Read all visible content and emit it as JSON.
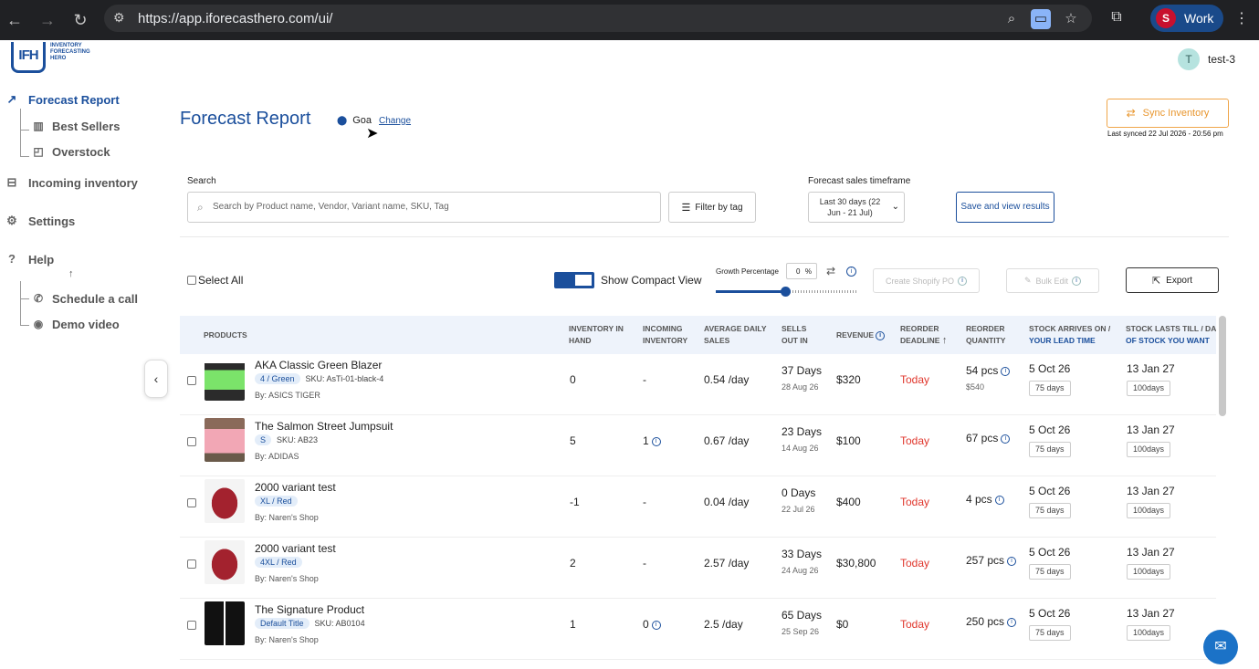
{
  "browser": {
    "url": "https://app.iforecasthero.com/ui/",
    "profile_label": "Work"
  },
  "logo": {
    "mark": "IFH",
    "line1": "INVENTORY",
    "line2": "FORECASTING",
    "line3": "HERO"
  },
  "user": {
    "initial": "T",
    "name": "test-3"
  },
  "sidebar": {
    "forecast_report": "Forecast Report",
    "best_sellers": "Best Sellers",
    "overstock": "Overstock",
    "incoming_inventory": "Incoming inventory",
    "settings": "Settings",
    "help": "Help",
    "schedule_call": "Schedule a call",
    "demo_video": "Demo video"
  },
  "header": {
    "title": "Forecast Report",
    "location": "Goa",
    "change_label": "Change",
    "sync_label": "Sync Inventory",
    "last_synced": "Last synced 22 Jul 2026 - 20:56 pm"
  },
  "filters": {
    "search_label": "Search",
    "search_placeholder": "Search by Product name, Vendor, Variant name, SKU, Tag",
    "filter_label": "Filter by tag",
    "timeframe_label": "Forecast sales timeframe",
    "timeframe_value": "Last 30 days (22 Jun - 21 Jul)",
    "save_label": "Save and view results"
  },
  "toolbar": {
    "select_all": "Select All",
    "compact_view": "Show Compact View",
    "compact_view_on": true,
    "growth_label": "Growth Percentage",
    "growth_value": "0",
    "growth_unit": "%",
    "growth_slider_level": 0.5,
    "create_po": "Create Shopify PO",
    "bulk_edit": "Bulk Edit",
    "export": "Export"
  },
  "table": {
    "headers": {
      "products": "PRODUCTS",
      "inv_hand_1": "INVENTORY IN",
      "inv_hand_2": "HAND",
      "incoming_1": "INCOMING",
      "incoming_2": "INVENTORY",
      "avg_1": "AVERAGE DAILY",
      "avg_2": "SALES",
      "sells_1": "SELLS",
      "sells_2": "OUT IN",
      "revenue": "REVENUE",
      "deadline_1": "REORDER",
      "deadline_2": "DEADLINE",
      "qty_1": "REORDER",
      "qty_2": "QUANTITY",
      "arrives_1": "STOCK ARRIVES ON /",
      "arrives_2": "YOUR LEAD TIME",
      "lasts_1": "STOCK LASTS TILL / DA",
      "lasts_2": "OF STOCK YOU WANT"
    },
    "rows": [
      {
        "name": "AKA Classic Green Blazer",
        "variant": "4 / Green",
        "sku": "SKU: AsTi-01-black-4",
        "vendor": "By: ASICS TIGER",
        "inv": "0",
        "incoming": "-",
        "avg": "0.54 /day",
        "sells": "37 Days",
        "sells_date": "28 Aug 26",
        "revenue": "$320",
        "deadline": "Today",
        "qty": "54 pcs",
        "qty_value": "$540",
        "arrives": "5 Oct 26",
        "lead": "75  days",
        "lasts": "13 Jan 27",
        "want": "100days"
      },
      {
        "name": "The Salmon Street Jumpsuit",
        "variant": "S",
        "sku": "SKU: AB23",
        "vendor": "By: ADIDAS",
        "inv": "5",
        "incoming": "1",
        "avg": "0.67 /day",
        "sells": "23 Days",
        "sells_date": "14 Aug 26",
        "revenue": "$100",
        "deadline": "Today",
        "qty": "67 pcs",
        "qty_value": "",
        "arrives": "5 Oct 26",
        "lead": "75  days",
        "lasts": "13 Jan 27",
        "want": "100days"
      },
      {
        "name": "2000 variant test",
        "variant": "XL / Red",
        "sku": "",
        "vendor": "By: Naren's Shop",
        "inv": "-1",
        "incoming": "-",
        "avg": "0.04 /day",
        "sells": "0 Days",
        "sells_date": "22 Jul 26",
        "revenue": "$400",
        "deadline": "Today",
        "qty": "4 pcs",
        "qty_value": "",
        "arrives": "5 Oct 26",
        "lead": "75  days",
        "lasts": "13 Jan 27",
        "want": "100days"
      },
      {
        "name": "2000 variant test",
        "variant": "4XL / Red",
        "sku": "",
        "vendor": "By: Naren's Shop",
        "inv": "2",
        "incoming": "-",
        "avg": "2.57 /day",
        "sells": "33 Days",
        "sells_date": "24 Aug 26",
        "revenue": "$30,800",
        "deadline": "Today",
        "qty": "257 pcs",
        "qty_value": "",
        "arrives": "5 Oct 26",
        "lead": "75  days",
        "lasts": "13 Jan 27",
        "want": "100days"
      },
      {
        "name": "The Signature Product",
        "variant": "Default Title",
        "sku": "SKU: AB0104",
        "vendor": "By: Naren's Shop",
        "inv": "1",
        "incoming": "0",
        "avg": "2.5 /day",
        "sells": "65 Days",
        "sells_date": "25 Sep 26",
        "revenue": "$0",
        "deadline": "Today",
        "qty": "250 pcs",
        "qty_value": "",
        "arrives": "5 Oct 26",
        "lead": "75  days",
        "lasts": "13 Jan 27",
        "want": "100days"
      }
    ]
  },
  "colors": {
    "brand": "#1b4f9c",
    "deadline": "#e0362c",
    "sync": "#e8962e"
  }
}
